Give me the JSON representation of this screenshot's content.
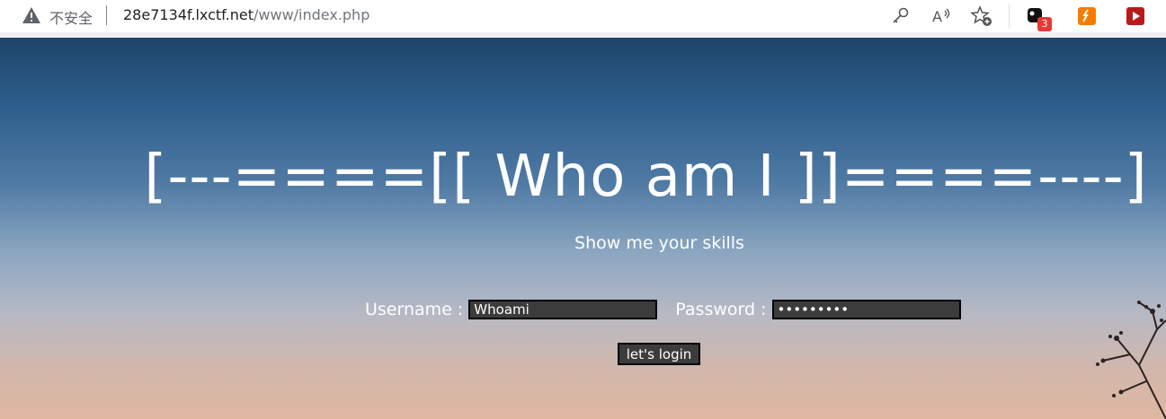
{
  "browser": {
    "security_text": "不安全",
    "url_host": "28e7134f.lxctf.net",
    "url_path": "/www/index.php",
    "extension_badge_count": "3"
  },
  "page": {
    "title": "[---====[[ Who am I ]]====----]",
    "subtitle": "Show me your skills",
    "username_label": "Username :",
    "username_value": "Whoami",
    "password_label": "Password :",
    "password_value": "*********",
    "login_button": "let's login"
  }
}
